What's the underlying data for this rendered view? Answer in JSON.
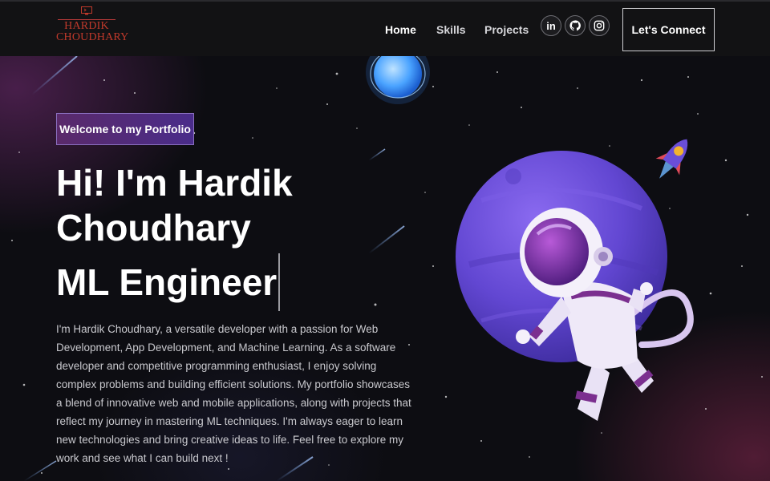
{
  "brand": {
    "line1": "HARDIK",
    "line2": "CHOUDHARY",
    "color": "#c0392b"
  },
  "nav": {
    "links": [
      {
        "label": "Home",
        "active": true
      },
      {
        "label": "Skills",
        "active": false
      },
      {
        "label": "Projects",
        "active": false
      }
    ],
    "socials": [
      {
        "icon": "linkedin-icon",
        "label": "in"
      },
      {
        "icon": "github-icon"
      },
      {
        "icon": "instagram-icon"
      }
    ],
    "cta_label": "Let's Connect"
  },
  "hero": {
    "badge": "Welcome to my Portfolio",
    "headline_line1": "Hi! I'm Hardik",
    "headline_line2": "Choudhary",
    "role": "ML Engineer",
    "bio": "I'm Hardik Choudhary, a versatile developer with a passion for Web Development, App Development, and Machine Learning. As a software developer and competitive programming enthusiast, I enjoy solving complex problems and building efficient solutions. My portfolio showcases a blend of innovative web and mobile applications, along with projects that reflect my journey in mastering ML techniques. I'm always eager to learn new technologies and bring creative ideas to life. Feel free to explore my work and see what I can build next !"
  },
  "colors": {
    "background": "#0b0b0e",
    "navbar": "#121214",
    "badge_from": "#5a2a6a",
    "badge_to": "#4a2c8a",
    "planet": "#6a4bd6",
    "suit_accent": "#7b2f8f"
  }
}
